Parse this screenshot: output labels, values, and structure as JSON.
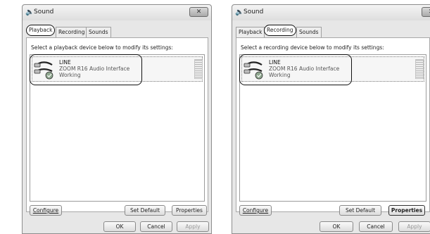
{
  "windows": [
    {
      "title": "Sound",
      "tabs": [
        "Playback",
        "Recording",
        "Sounds"
      ],
      "active_tab": "Playback",
      "instruction": "Select a playback device below to modify its settings:",
      "device": {
        "name": "LINE",
        "description": "ZOOM R16 Audio Interface",
        "status": "Working"
      },
      "buttons": {
        "configure": "Configure",
        "set_default": "Set Default",
        "properties": "Properties",
        "ok": "OK",
        "cancel": "Cancel",
        "apply": "Apply"
      }
    },
    {
      "title": "Sound",
      "tabs": [
        "Playback",
        "Recording",
        "Sounds"
      ],
      "active_tab": "Recording",
      "instruction": "Select a recording device below to modify its settings:",
      "device": {
        "name": "LINE",
        "description": "ZOOM R16 Audio Interface",
        "status": "Working"
      },
      "buttons": {
        "configure": "Configure",
        "set_default": "Set Default",
        "properties": "Properties",
        "ok": "OK",
        "cancel": "Cancel",
        "apply": "Apply"
      }
    }
  ],
  "icons": {
    "title": "speaker-icon",
    "close": "close-icon",
    "device": "cable-jack-icon",
    "check": "check-badge-icon"
  }
}
